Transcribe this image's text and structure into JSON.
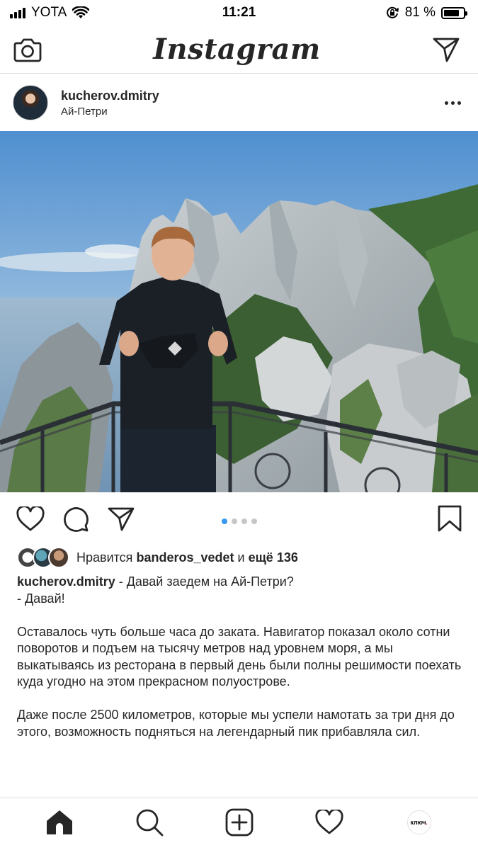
{
  "status_bar": {
    "carrier": "YOTA",
    "time": "11:21",
    "battery_percent": "81 %",
    "battery_level": 0.81
  },
  "header": {
    "logo_text": "Instagram",
    "camera_icon": "camera-icon",
    "direct_icon": "paper-plane-icon"
  },
  "post": {
    "username": "kucherov.dmitry",
    "location": "Ай-Петри",
    "carousel": {
      "total": 4,
      "current": 1
    },
    "likes": {
      "prefix": "Нравится",
      "user": "banderos_vedet",
      "middle": "и",
      "others": "ещё 136"
    },
    "caption": {
      "username": "kucherov.dmitry",
      "first_line": " - Давай заедем на Ай-Петри?",
      "second_line": "- Давай!",
      "paragraph_1": "Оставалось чуть больше часа до заката. Навигатор показал около сотни поворотов и подъем на тысячу метров над уровнем моря, а мы выкатываясь из ресторана в первый день были полны решимости поехать куда угодно на этом прекрасном полуострове.",
      "paragraph_2": "Даже после 2500 километров, которые мы успели намотать за три дня до этого, возможность подняться на легендарный пик прибавляла сил."
    }
  },
  "tab_bar": {
    "items": [
      "home-icon",
      "search-icon",
      "new-post-icon",
      "activity-heart-icon",
      "profile-avatar"
    ],
    "profile_label_a": "ключ",
    "profile_label_b": "."
  },
  "colors": {
    "accent_blue": "#3897f0",
    "text": "#262626",
    "divider": "#dbdbdb"
  }
}
